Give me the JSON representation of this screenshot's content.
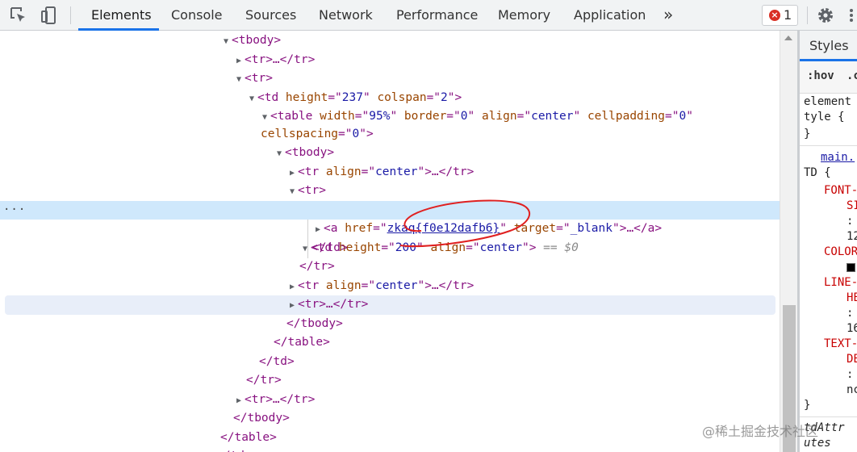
{
  "toolbar": {
    "tabs": [
      "Elements",
      "Console",
      "Sources",
      "Network",
      "Performance",
      "Memory",
      "Application"
    ],
    "more_label": "»",
    "error_count": "1",
    "error_glyph": "×",
    "icons": [
      "inspect-element-icon",
      "device-toggle-icon",
      "gear-icon",
      "kebab-menu-icon"
    ]
  },
  "tree": {
    "rows": {
      "r0": {
        "open": "<",
        "tag": "tbody",
        "close": ">"
      },
      "r1": {
        "open": "<",
        "tag": "tr",
        "mid": ">…</",
        "tag2": "tr",
        "close": ">"
      },
      "r2": {
        "open": "<",
        "tag": "tr",
        "close": ">"
      },
      "r3": {
        "open": "<",
        "tag": "td",
        "a1": " height",
        "eq": "=\"",
        "v1": "237",
        "q": "\"",
        "a2": " colspan",
        "v2": "2",
        "close": ">"
      },
      "r4": {
        "open": "<",
        "tag": "table",
        "a1": " width",
        "v1": "95%",
        "a2": " border",
        "v2": "0",
        "a3": " align",
        "v3": "center",
        "a4": " cellpadding",
        "v4": "0"
      },
      "r5": {
        "a1": "cellspacing",
        "v1": "0",
        "close": ">"
      },
      "r6": {
        "open": "<",
        "tag": "tbody",
        "close": ">"
      },
      "r7": {
        "open": "<",
        "tag": "tr",
        "a1": " align",
        "v1": "center",
        "mid": ">…</",
        "tag2": "tr",
        "close": ">"
      },
      "r8": {
        "open": "<",
        "tag": "tr",
        "close": ">"
      },
      "r9": {
        "open": "<",
        "tag": "td",
        "a1": " height",
        "v1": "200",
        "a2": " align",
        "v2": "center",
        "close": ">",
        "marker": " == $0"
      },
      "r10": {
        "open": "<",
        "tag": "a",
        "a1": " href",
        "v1": "zkaq{f0e12dafb6}",
        "a2": " target",
        "v2": "_blank",
        "mid": ">…</",
        "tag2": "a",
        "close": ">"
      },
      "r11": {
        "open": "</",
        "tag": "td",
        "close": ">"
      },
      "r12": {
        "open": "</",
        "tag": "tr",
        "close": ">"
      },
      "r13": {
        "open": "<",
        "tag": "tr",
        "a1": " align",
        "v1": "center",
        "mid": ">…</",
        "tag2": "tr",
        "close": ">"
      },
      "r14": {
        "open": "<",
        "tag": "tr",
        "mid": ">…</",
        "tag2": "tr",
        "close": ">"
      },
      "r15": {
        "open": "</",
        "tag": "tbody",
        "close": ">"
      },
      "r16": {
        "open": "</",
        "tag": "table",
        "close": ">"
      },
      "r17": {
        "open": "</",
        "tag": "td",
        "close": ">"
      },
      "r18": {
        "open": "</",
        "tag": "tr",
        "close": ">"
      },
      "r19": {
        "open": "<",
        "tag": "tr",
        "mid": ">…</",
        "tag2": "tr",
        "close": ">"
      },
      "r20": {
        "open": "</",
        "tag": "tbody",
        "close": ">"
      },
      "r21": {
        "open": "</",
        "tag": "table",
        "close": ">"
      },
      "r22": {
        "open": "</",
        "tag": "td",
        "close": ">"
      }
    },
    "selected_dots": "···"
  },
  "styles": {
    "tab_label": "Styles",
    "hov_label": ":hov",
    "cls_label": ".c",
    "lines": {
      "l1": "element",
      "l2": "tyle {",
      "l3": "}",
      "l4": "main.",
      "l5": "TD {",
      "l6": "FONT-",
      "l7": "SI",
      "l8": ":",
      "l9": "12",
      "l10": "COLOR",
      "l11": "LINE-",
      "l12": "HE",
      "l13": ":",
      "l14": "16",
      "l15": "TEXT-",
      "l16": "DE",
      "l17": ":",
      "l18": "nc",
      "l19": "}",
      "l20": "tdAttr",
      "l21": "utes"
    },
    "swatch_color": "#000000"
  },
  "watermark": "@稀土掘金技术社区",
  "colors": {
    "accent": "#1a73e8",
    "selected_row": "#cfe8fc",
    "tag": "#881280",
    "attr_name": "#994500",
    "attr_value": "#1a1aa6",
    "annotation_red": "#e02020"
  }
}
